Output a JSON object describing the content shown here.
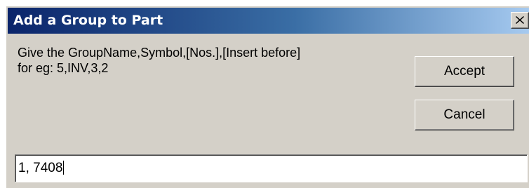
{
  "window": {
    "title": "Add a Group to Part",
    "close_icon": "close-icon"
  },
  "prompt": {
    "line1": "Give the GroupName,Symbol,[Nos.],[Insert before]",
    "line2": "for eg: 5,INV,3,2"
  },
  "buttons": {
    "accept_label": "Accept",
    "cancel_label": "Cancel"
  },
  "input": {
    "value": "1, 7408"
  },
  "colors": {
    "title_gradient_start": "#0a246a",
    "title_gradient_end": "#a6caf0",
    "dialog_face": "#d4d0c8"
  }
}
